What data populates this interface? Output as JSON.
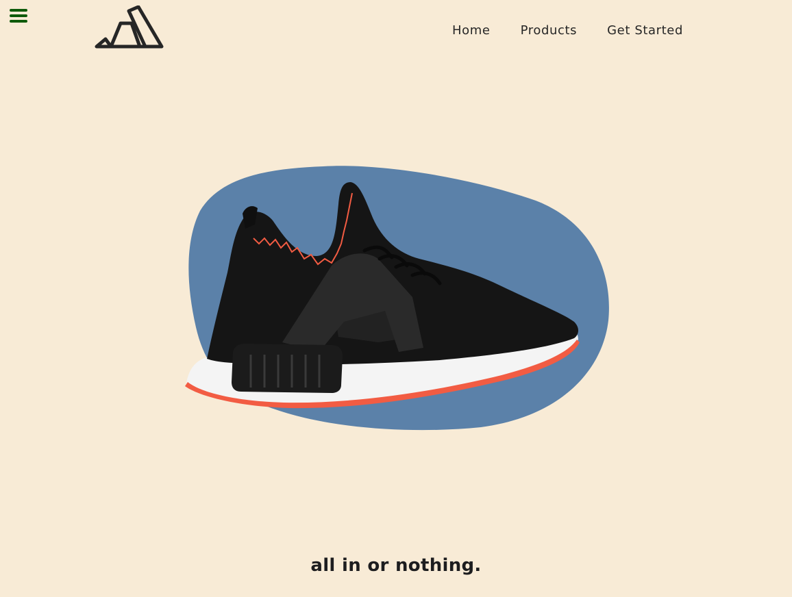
{
  "header": {
    "nav": [
      {
        "label": "Home"
      },
      {
        "label": "Products"
      },
      {
        "label": "Get Started"
      }
    ]
  },
  "hero": {
    "tagline": "all in or nothing.",
    "image": "sneaker-product-image"
  },
  "icons": {
    "menu": "hamburger-menu-icon",
    "logo": "brand-logo-icon"
  },
  "colors": {
    "background": "#f8ebd6",
    "menu_icon": "#0e5a0a",
    "blob": "#5b81a9",
    "text": "#262626",
    "accent": "#f25c43"
  }
}
